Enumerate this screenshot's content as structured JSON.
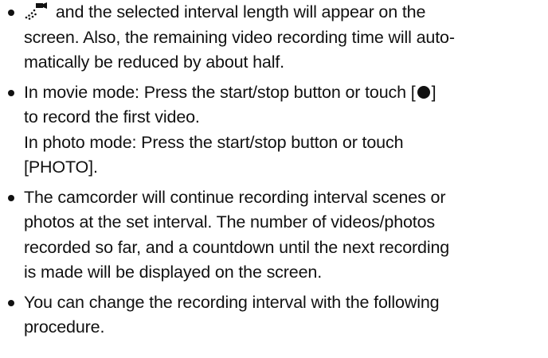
{
  "bullets": [
    {
      "lines": [
        " and the selected interval length will appear on the",
        "screen. Also, the remaining video recording time will auto-",
        "matically be reduced by about half."
      ]
    },
    {
      "line1_pre": "In movie mode: Press the start/stop button or touch [",
      "line1_post": "]",
      "lines_rest": [
        "to record the first video.",
        "In photo mode: Press the start/stop button or touch",
        "[PHOTO]."
      ]
    },
    {
      "lines": [
        "The camcorder will continue recording interval scenes or",
        "photos at the set interval. The number of videos/photos",
        "recorded so far, and a countdown until the next recording",
        "is made will be displayed on the screen."
      ]
    },
    {
      "lines": [
        "You can change the recording interval with the following",
        "procedure."
      ]
    }
  ],
  "icons": {
    "interval_recording": "interval-recording-icon",
    "record": "record-icon"
  }
}
